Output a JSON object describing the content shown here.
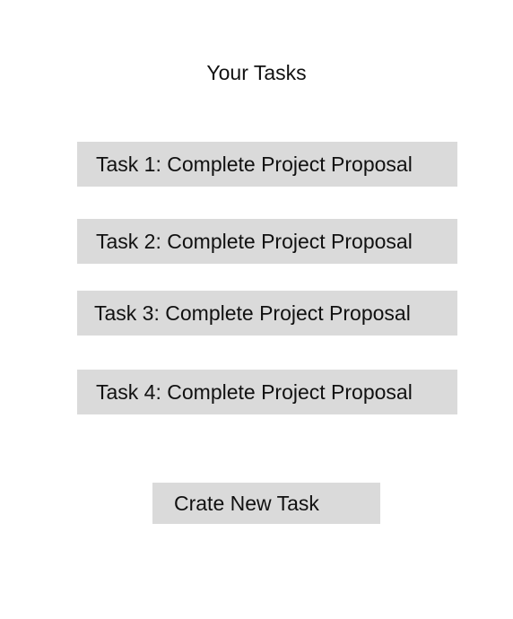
{
  "header": {
    "title": "Your Tasks"
  },
  "tasks": [
    {
      "label": "Task 1: Complete Project Proposal"
    },
    {
      "label": "Task 2: Complete Project Proposal"
    },
    {
      "label": "Task 3: Complete Project Proposal"
    },
    {
      "label": "Task 4: Complete Project Proposal"
    }
  ],
  "actions": {
    "create_label": "Crate New Task"
  },
  "colors": {
    "background": "#ffffff",
    "item_background": "#dadada",
    "text": "#111111"
  }
}
